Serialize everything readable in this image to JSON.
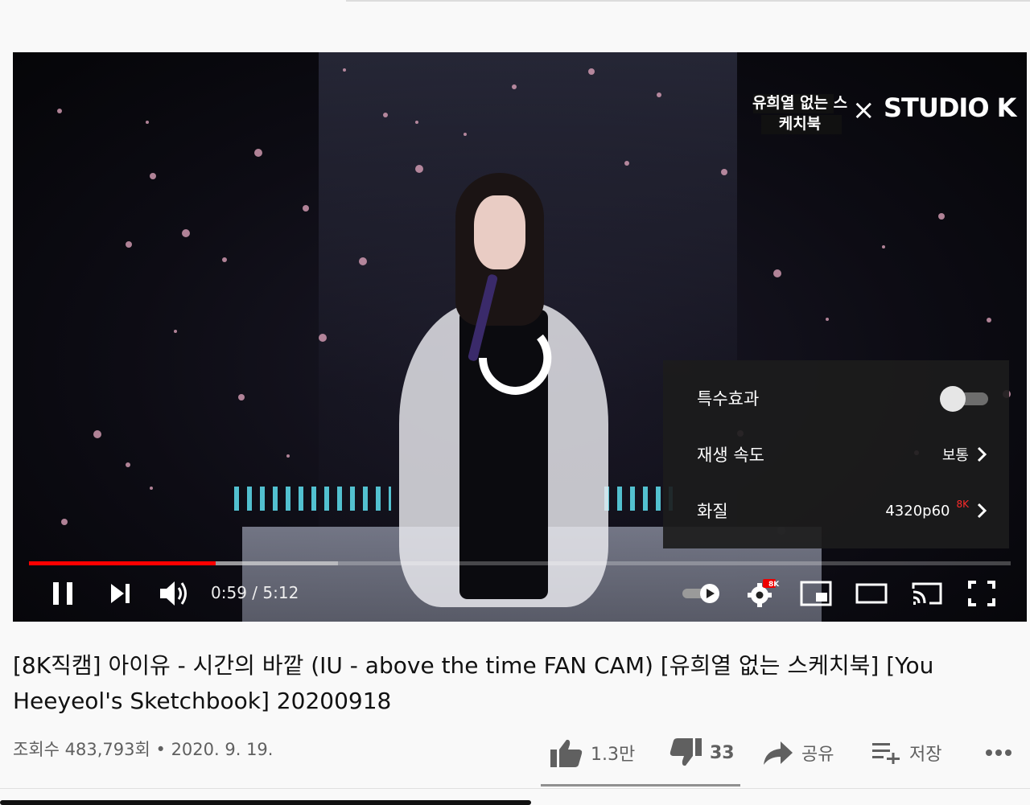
{
  "player": {
    "channel_logo_text": "유희열 없는 스케치북",
    "studio_logo_text": "STUDIO K",
    "progress_played_fraction": 0.19,
    "progress_buffered_fraction": 0.315,
    "time_current": "0:59",
    "time_separator": "/",
    "time_total": "5:12",
    "settings_badge": "8K",
    "controls": {
      "play_pause_icon": "pause-icon",
      "next_icon": "next-icon",
      "volume_icon": "volume-icon",
      "autoplay_icon": "autoplay-toggle-icon",
      "settings_icon": "gear-icon",
      "miniplayer_icon": "miniplayer-icon",
      "theater_icon": "theater-icon",
      "cast_icon": "cast-icon",
      "fullscreen_icon": "fullscreen-icon"
    }
  },
  "settings_menu": {
    "annotations_label": "특수효과",
    "annotations_on": false,
    "speed_label": "재생 속도",
    "speed_value": "보통",
    "quality_label": "화질",
    "quality_value": "4320p60",
    "quality_badge": "8K"
  },
  "video": {
    "title": "[8K직캠] 아이유 - 시간의 바깥 (IU - above the time FAN CAM) [유희열 없는 스케치북] [You Heeyeol's Sketchbook] 20200918",
    "views": "조회수 483,793회",
    "dot": "•",
    "date": "2020. 9. 19."
  },
  "actions": {
    "like_count": "1.3만",
    "dislike_count": "33",
    "share_label": "공유",
    "save_label": "저장",
    "more_icon": "more-icon"
  },
  "colors": {
    "accent": "#ff0000",
    "menu_bg": "#1c1c1c",
    "text_primary": "#111111",
    "text_secondary": "#606060"
  }
}
